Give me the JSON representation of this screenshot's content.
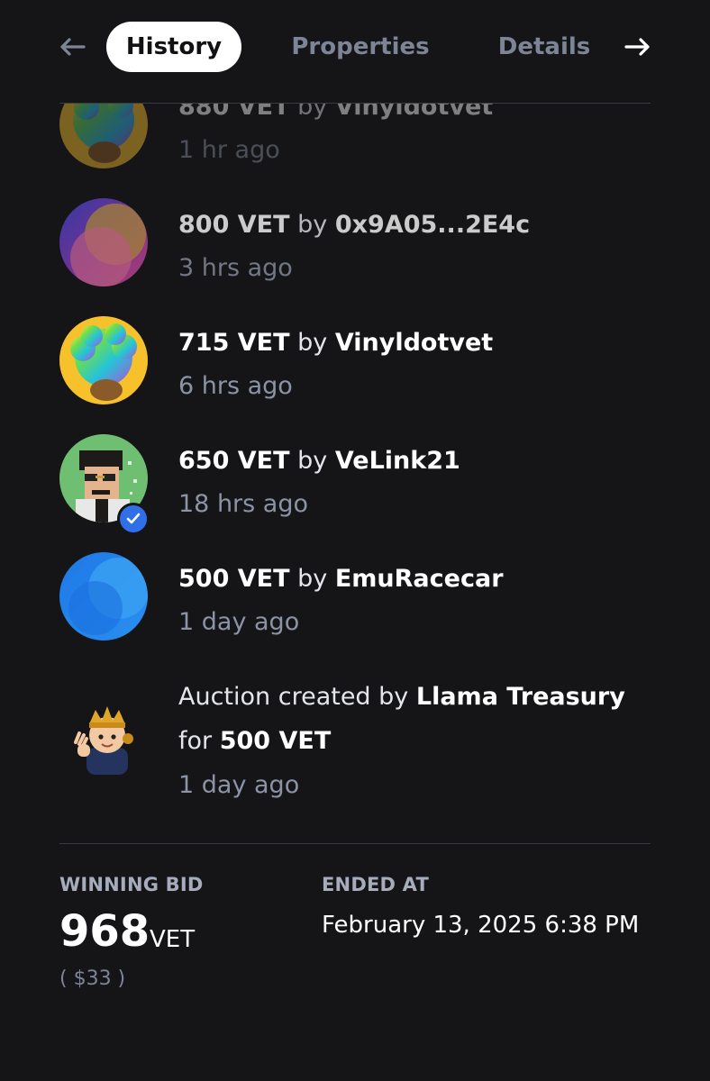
{
  "tabs": {
    "history": "History",
    "properties": "Properties",
    "details": "Details",
    "active": "history"
  },
  "history": [
    {
      "amount": "880 VET",
      "by_word": "by",
      "bidder": "Vinyldotvet",
      "time": "1 hr ago",
      "avatar": "afro-rainbow-avatar"
    },
    {
      "amount": "800 VET",
      "by_word": "by",
      "bidder": "0x9A05...2E4c",
      "time": "3 hrs ago",
      "avatar": "gradient-circle-avatar"
    },
    {
      "amount": "715 VET",
      "by_word": "by",
      "bidder": "Vinyldotvet",
      "time": "6 hrs ago",
      "avatar": "afro-rainbow-avatar"
    },
    {
      "amount": "650 VET",
      "by_word": "by",
      "bidder": "VeLink21",
      "time": "18 hrs ago",
      "avatar": "pixel-punk-avatar",
      "verified": true
    },
    {
      "amount": "500 VET",
      "by_word": "by",
      "bidder": "EmuRacecar",
      "time": "1 day ago",
      "avatar": "blue-circle-avatar"
    }
  ],
  "auction_created": {
    "prefix": "Auction created by",
    "creator": "Llama Treasury",
    "for_word": "for",
    "amount": "500 VET",
    "time": "1 day ago",
    "avatar": "llama-king-avatar"
  },
  "footer": {
    "winning_bid_label": "WINNING BID",
    "winning_bid_amount": "968",
    "winning_bid_unit": "VET",
    "winning_bid_usd": "( $33 )",
    "ended_at_label": "ENDED AT",
    "ended_at_value": "February 13, 2025 6:38 PM"
  },
  "colors": {
    "background": "#151517",
    "muted_text": "#8b93a4",
    "label_text": "#a6acbb",
    "divider": "#3a3b42",
    "active_tab_bg": "#ffffff",
    "verified_badge": "#2f6fe8"
  }
}
